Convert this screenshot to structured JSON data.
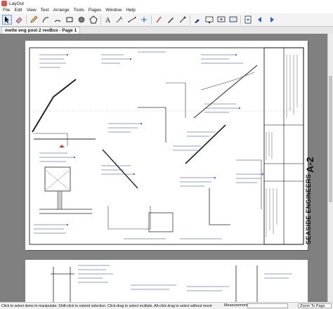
{
  "window": {
    "title": "LayOut"
  },
  "menu": [
    "File",
    "Edit",
    "View",
    "Text",
    "Arrange",
    "Tools",
    "Pages",
    "Window",
    "Help"
  ],
  "toolbar": {
    "tools": [
      "select-arrow-icon",
      "eraser-icon",
      "pencil-icon",
      "line-icon",
      "arc-icon",
      "rectangle-icon",
      "circle-icon",
      "polygon-icon",
      "text-icon",
      "label-icon",
      "dimension-icon",
      "split-icon",
      "join-icon",
      "sample-style-icon",
      "paint-bucket-icon",
      "eye-dropper-icon",
      "paint-icon",
      "screen-icon",
      "presentation-icon",
      "monitor-icon",
      "add-page-icon",
      "prev-page-icon",
      "next-page-icon"
    ]
  },
  "document": {
    "tab_label": "mette eng pool 2 revBox - Page 1"
  },
  "title_block": {
    "firm": "SEASIDE ENGINEERS",
    "sheet": "A-2"
  },
  "status": {
    "hint": "Click to select items to manipulate. Shift-click to extend selection. Click-drag to select multiple. Alt-click drag to select without moving. Double-click t",
    "measurements_label": "Measurements",
    "zoom": "Zoom To Page"
  },
  "colors": {
    "accent": "#1e3fa8",
    "canvas": "#808080"
  }
}
